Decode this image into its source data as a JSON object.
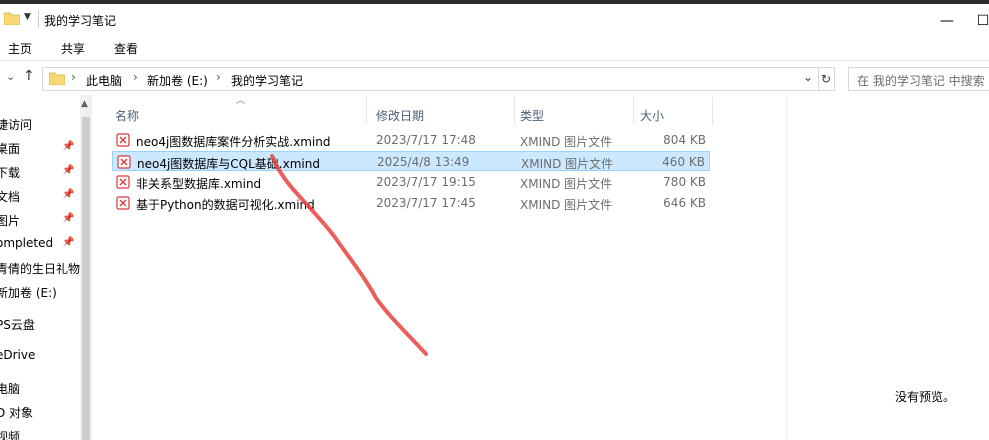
{
  "window": {
    "title": "我的学习笔记",
    "buttons": {
      "minimize": "—",
      "maximize": "☐"
    }
  },
  "ribbon": {
    "tabs": [
      "主页",
      "共享",
      "查看"
    ]
  },
  "address": {
    "crumbs": [
      "此电脑",
      "新加卷 (E:)",
      "我的学习笔记"
    ],
    "search_placeholder": "在 我的学习笔记 中搜索"
  },
  "nav": {
    "items": [
      {
        "label": "捷访问",
        "pinned": false
      },
      {
        "label": "桌面",
        "pinned": true
      },
      {
        "label": "下载",
        "pinned": true
      },
      {
        "label": "文档",
        "pinned": true
      },
      {
        "label": "图片",
        "pinned": true
      },
      {
        "label": "ompleted",
        "pinned": true
      },
      {
        "label": "青倩的生日礼物",
        "pinned": false
      },
      {
        "label": "新加卷 (E:)",
        "pinned": false
      },
      {
        "label": "PS云盘",
        "pinned": false
      },
      {
        "label": "eDrive",
        "pinned": false
      },
      {
        "label": "电脑",
        "pinned": false
      },
      {
        "label": "D 对象",
        "pinned": false
      },
      {
        "label": "视频",
        "pinned": false
      }
    ],
    "pin_glyph": "📌"
  },
  "columns": {
    "name": "名称",
    "date": "修改日期",
    "type": "类型",
    "size": "大小"
  },
  "files": [
    {
      "name": "neo4j图数据库案件分析实战.xmind",
      "date": "2023/7/17 17:48",
      "type": "XMIND 图片文件",
      "size": "804 KB",
      "selected": false
    },
    {
      "name": "neo4j图数据库与CQL基础.xmind",
      "date": "2025/4/8 13:49",
      "type": "XMIND 图片文件",
      "size": "460 KB",
      "selected": true
    },
    {
      "name": "非关系型数据库.xmind",
      "date": "2023/7/17 19:15",
      "type": "XMIND 图片文件",
      "size": "780 KB",
      "selected": false
    },
    {
      "name": "基于Python的数据可视化.xmind",
      "date": "2023/7/17 17:45",
      "type": "XMIND 图片文件",
      "size": "646 KB",
      "selected": false
    }
  ],
  "preview": {
    "text": "没有预览。"
  },
  "colors": {
    "selection": "#cce8ff",
    "selection_border": "#99d1ff",
    "folder": "#f8d775",
    "xmind_icon": "#d9383a",
    "scribble": "#e8423f"
  }
}
